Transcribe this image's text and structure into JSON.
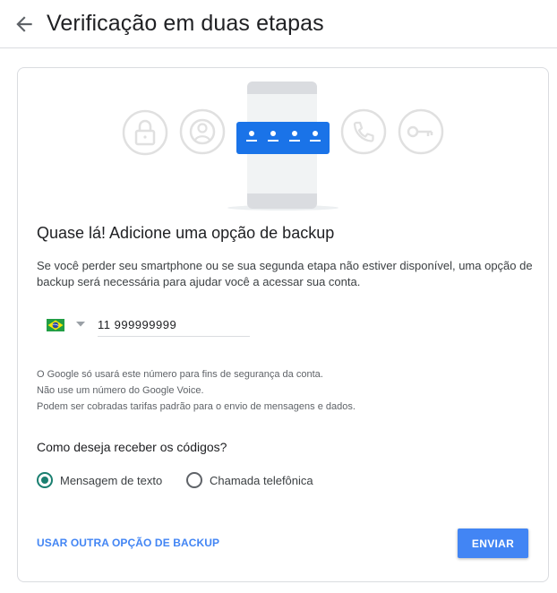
{
  "header": {
    "title": "Verificação em duas etapas",
    "back_icon": "arrow-back-icon"
  },
  "illustration": {
    "icons": [
      "lock-icon",
      "account-circle-icon",
      "phone-with-code-icon",
      "phone-call-icon",
      "key-icon"
    ],
    "accent_color": "#1a73e8"
  },
  "main": {
    "heading": "Quase lá! Adicione uma opção de backup",
    "description": "Se você perder seu smartphone ou se sua segunda etapa não estiver disponível, uma opção de backup será necessária para ajudar você a acessar sua conta.",
    "phone": {
      "country": "Brasil",
      "flag_icon": "brazil-flag-icon",
      "value": "11 999999999"
    },
    "notice": [
      "O Google só usará este número para fins de segurança da conta.",
      "Não use um número do Google Voice.",
      "Podem ser cobradas tarifas padrão para o envio de mensagens e dados."
    ],
    "question": "Como deseja receber os códigos?",
    "options": [
      {
        "label": "Mensagem de texto",
        "selected": true
      },
      {
        "label": "Chamada telefônica",
        "selected": false
      }
    ],
    "alt_link": "USAR OUTRA OPÇÃO DE BACKUP",
    "send_label": "ENVIAR"
  },
  "colors": {
    "primary": "#4285f4",
    "radio_checked": "#1a7f70",
    "divider": "#dadce0"
  }
}
